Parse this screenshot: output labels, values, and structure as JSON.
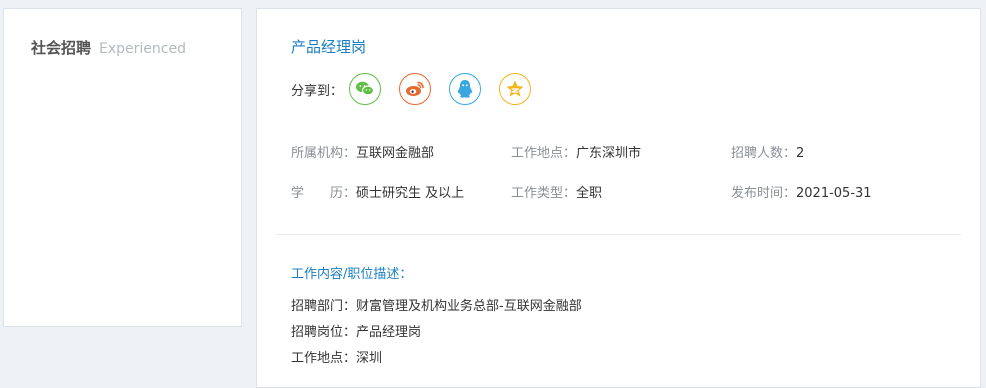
{
  "sidebar": {
    "title": "社会招聘",
    "title_en": "Experienced"
  },
  "job": {
    "title": "产品经理岗",
    "share_label": "分享到：",
    "share_icons": [
      {
        "name": "wechat-icon",
        "color": "#5fbf45"
      },
      {
        "name": "weibo-icon",
        "color": "#e8692e"
      },
      {
        "name": "qq-icon",
        "color": "#3aa7e0"
      },
      {
        "name": "qzone-icon",
        "color": "#f2b51c"
      }
    ],
    "meta": {
      "org_label": "所属机构：",
      "org_value": "互联网金融部",
      "location_label": "工作地点：",
      "location_value": "广东深圳市",
      "headcount_label": "招聘人数：",
      "headcount_value": "2",
      "education_label": "学　　历：",
      "education_value": "硕士研究生 及以上",
      "type_label": "工作类型：",
      "type_value": "全职",
      "date_label": "发布时间：",
      "date_value": "2021-05-31"
    },
    "description": {
      "title": "工作内容/职位描述：",
      "lines": [
        "招聘部门：财富管理及机构业务总部-互联网金融部",
        "招聘岗位：产品经理岗",
        "工作地点：深圳"
      ]
    }
  }
}
